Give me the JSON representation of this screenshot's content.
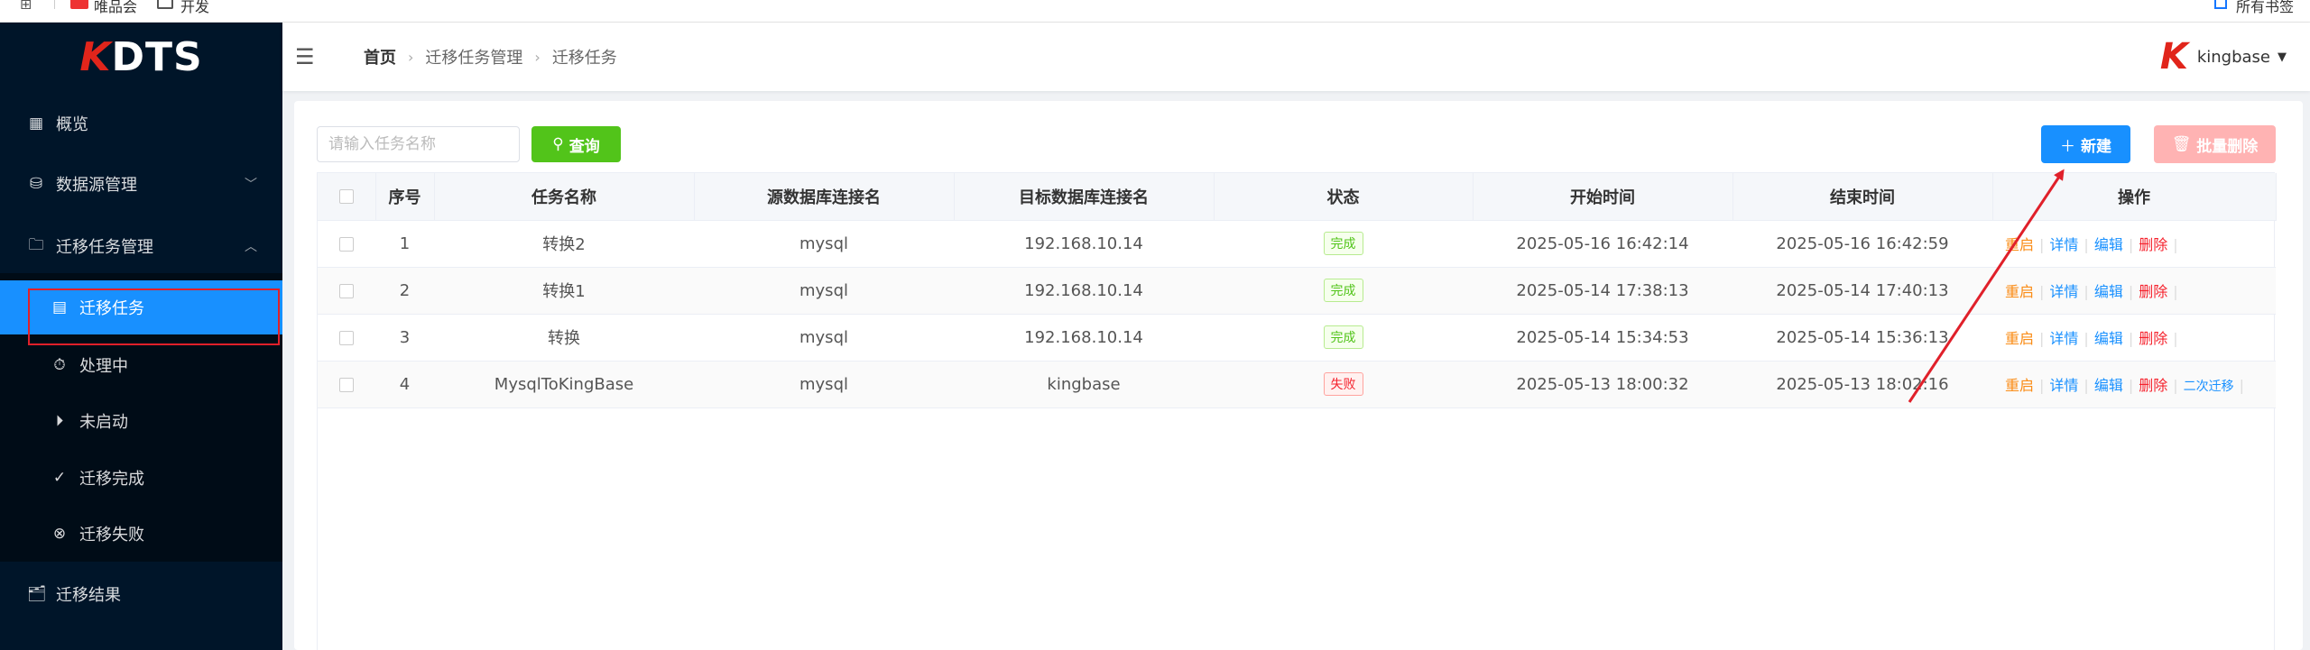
{
  "browser": {
    "bookmark1": "唯品会",
    "bookmark2": "开发",
    "right_label": "所有书签"
  },
  "sidebar": {
    "logo_k": "K",
    "logo_rest": "DTS",
    "items": [
      {
        "label": "概览"
      },
      {
        "label": "数据源管理"
      },
      {
        "label": "迁移任务管理"
      },
      {
        "label": "迁移任务"
      },
      {
        "label": "处理中"
      },
      {
        "label": "未启动"
      },
      {
        "label": "迁移完成"
      },
      {
        "label": "迁移失败"
      },
      {
        "label": "迁移结果"
      }
    ]
  },
  "header": {
    "breadcrumb": [
      "首页",
      "迁移任务管理",
      "迁移任务"
    ],
    "user_logo": "K",
    "user_name": "kingbase"
  },
  "toolbar": {
    "search_placeholder": "请输入任务名称",
    "query_label": "查询",
    "new_label": "新建",
    "batch_delete_label": "批量删除"
  },
  "table": {
    "columns": [
      "序号",
      "任务名称",
      "源数据库连接名",
      "目标数据库连接名",
      "状态",
      "开始时间",
      "结束时间",
      "操作"
    ],
    "rows": [
      {
        "no": "1",
        "name": "转换2",
        "source": "mysql",
        "target": "192.168.10.14",
        "status": "完成",
        "start": "2025-05-16 16:42:14",
        "end": "2025-05-16 16:42:59"
      },
      {
        "no": "2",
        "name": "转换1",
        "source": "mysql",
        "target": "192.168.10.14",
        "status": "完成",
        "start": "2025-05-14 17:38:13",
        "end": "2025-05-14 17:40:13"
      },
      {
        "no": "3",
        "name": "转换",
        "source": "mysql",
        "target": "192.168.10.14",
        "status": "完成",
        "start": "2025-05-14 15:34:53",
        "end": "2025-05-14 15:36:13"
      },
      {
        "no": "4",
        "name": "MysqlToKingBase",
        "source": "mysql",
        "target": "kingbase",
        "status": "失败",
        "start": "2025-05-13 18:00:32",
        "end": "2025-05-13 18:02:16"
      }
    ],
    "ops": {
      "restart": "重启",
      "detail": "详情",
      "edit": "编辑",
      "delete": "删除",
      "second_migrate": "二次迁移"
    }
  },
  "colors": {
    "sidebar_bg": "#001529",
    "primary": "#1890ff",
    "success": "#52c41a",
    "danger": "#f5222d",
    "annotation": "#e0202a"
  }
}
